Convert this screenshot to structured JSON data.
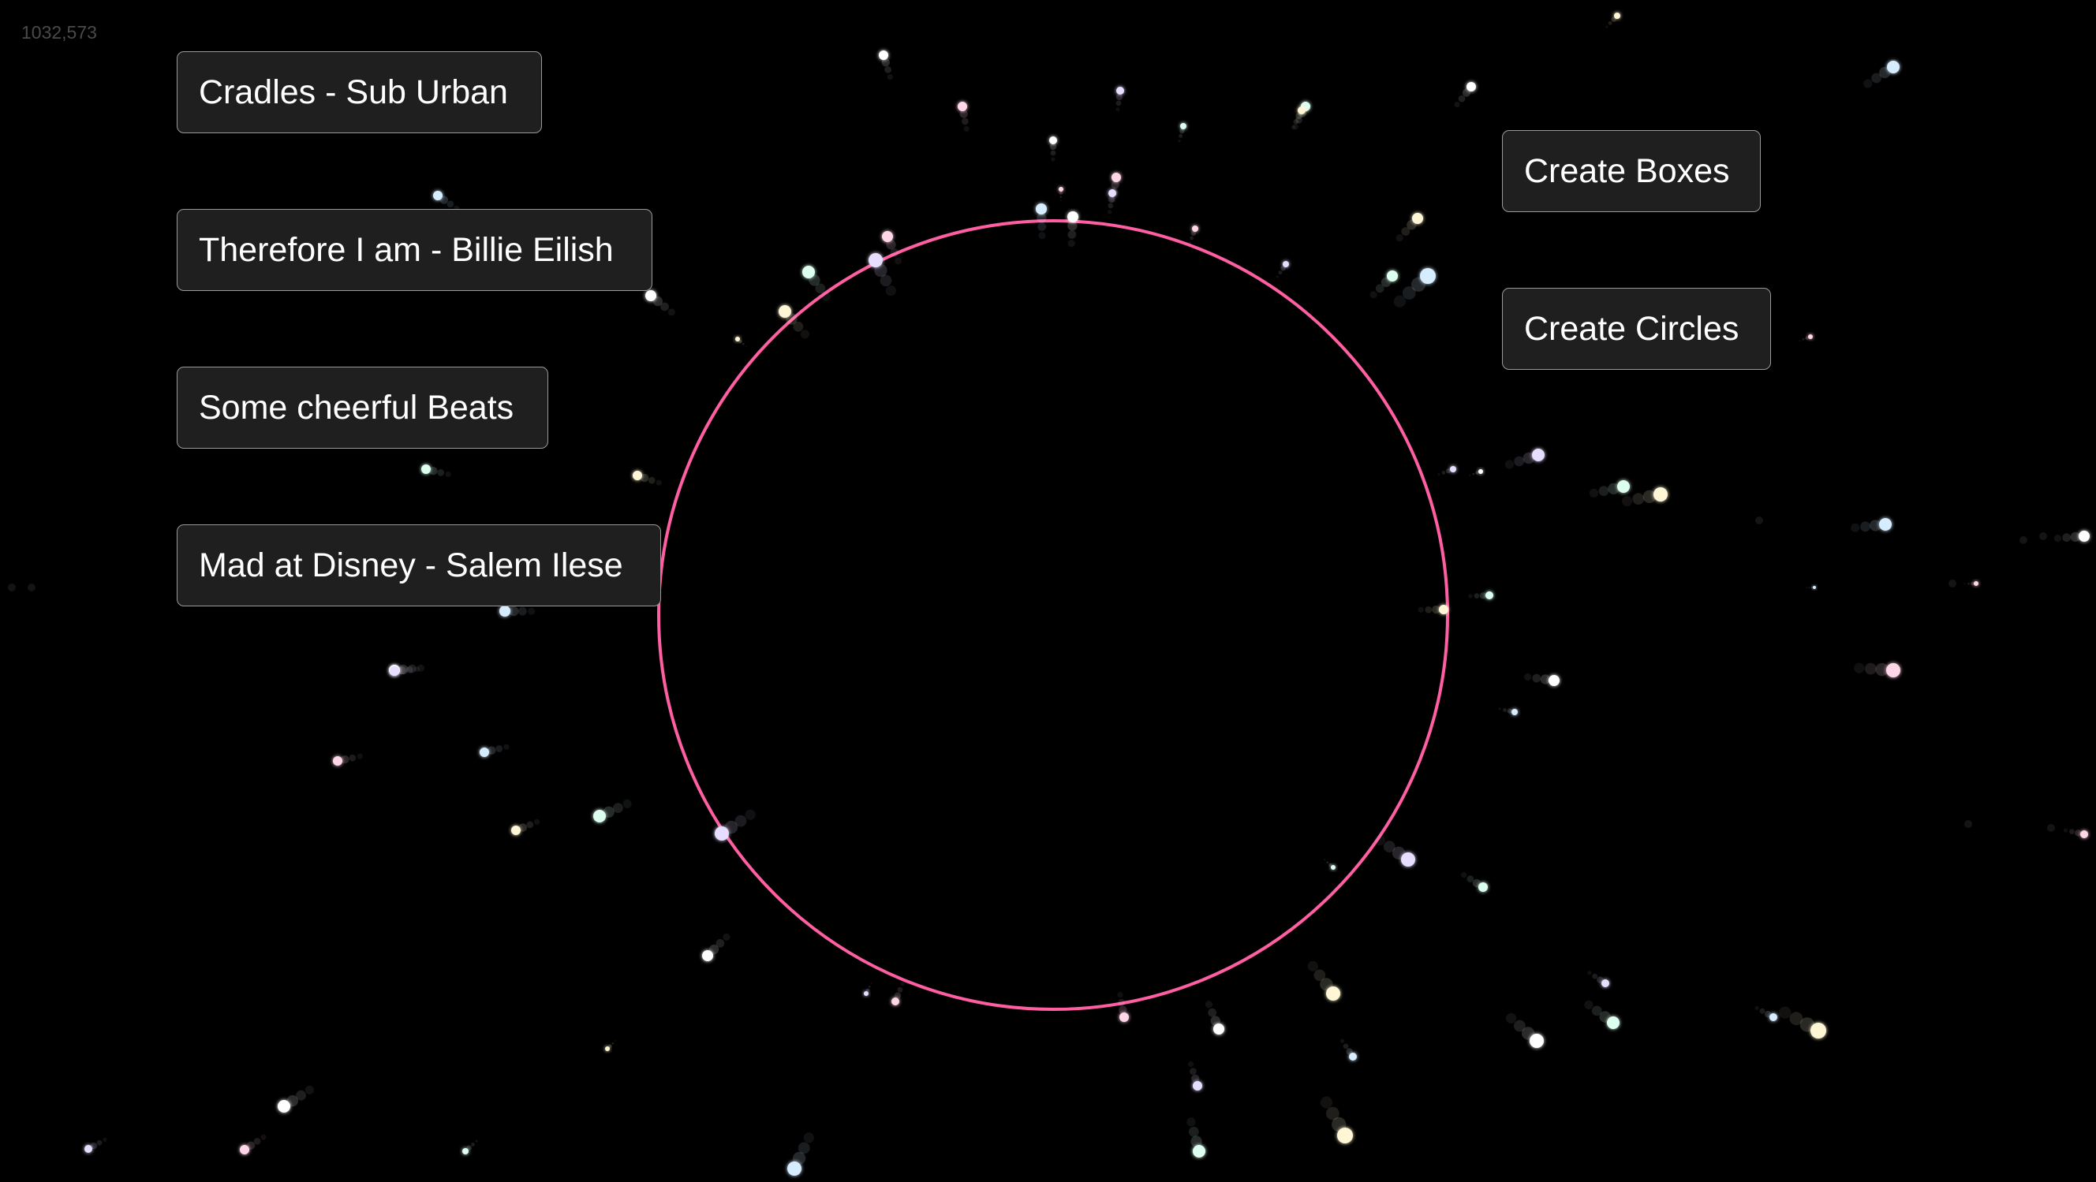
{
  "cursor_readout": "1032,573",
  "songs": [
    {
      "label": "Cradles - Sub Urban"
    },
    {
      "label": "Therefore I am - Billie Eilish"
    },
    {
      "label": "Some cheerful Beats"
    },
    {
      "label": "Mad at Disney - Salem Ilese"
    }
  ],
  "actions": {
    "create_boxes": "Create Boxes",
    "create_circles": "Create Circles"
  },
  "colors": {
    "background": "#000000",
    "ring": "#ff5fa2",
    "button_bg": "#1f1f1f",
    "button_border": "#9a9a9a",
    "button_text": "#ffffff"
  }
}
